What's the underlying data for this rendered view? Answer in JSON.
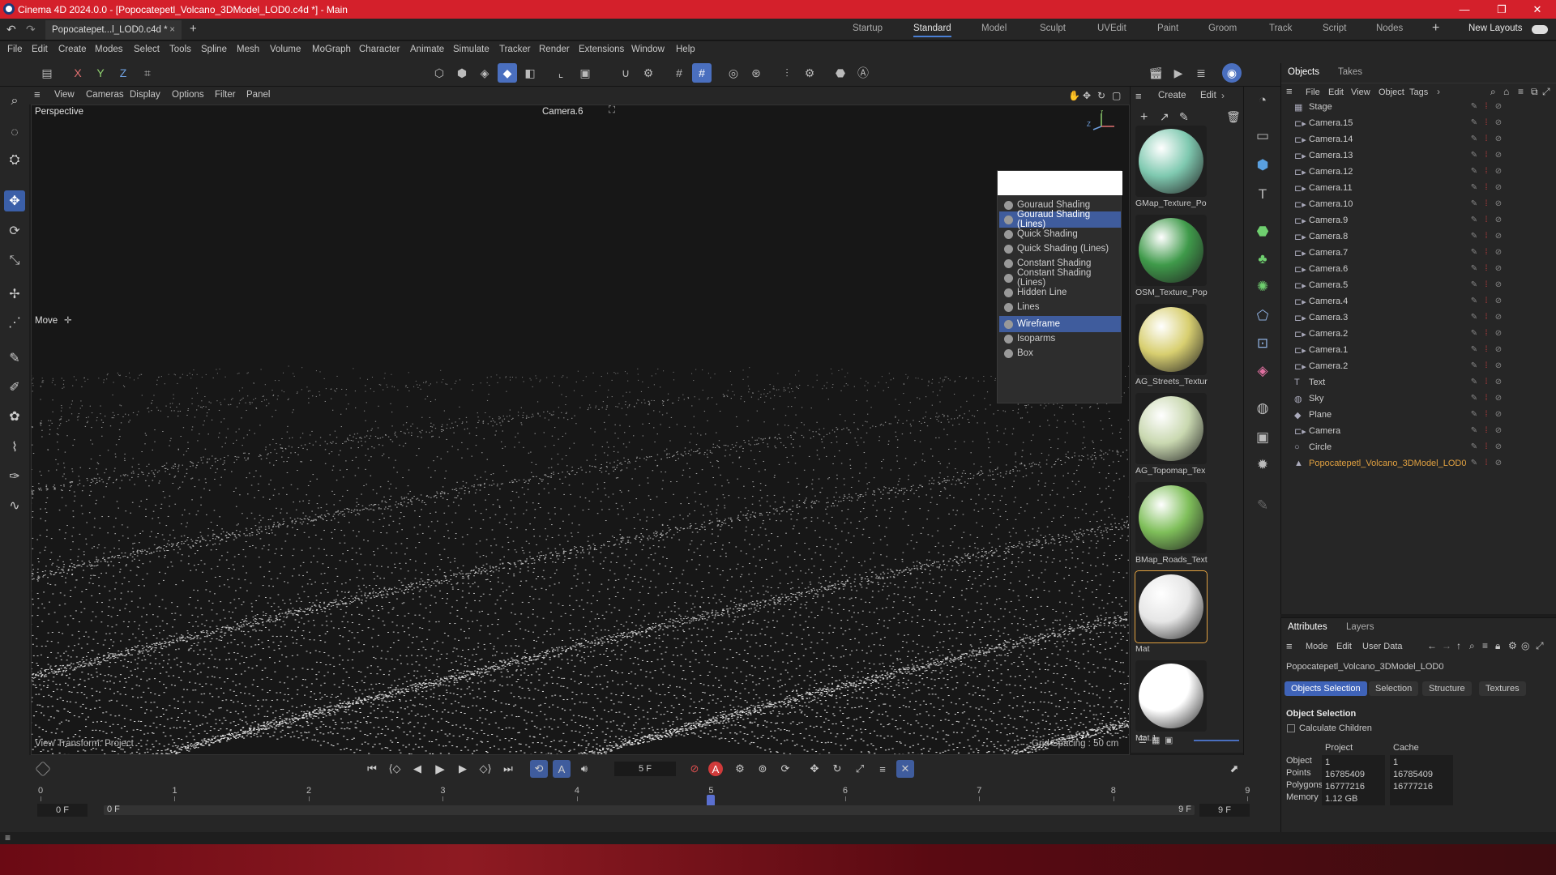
{
  "window": {
    "title": "Cinema 4D 2024.0.0 - [Popocatepetl_Volcano_3DModel_LOD0.c4d *] - Main",
    "minimize": "—",
    "maximize": "❐",
    "close": "✕"
  },
  "doc_tab": {
    "label": "Popocatepet...l_LOD0.c4d *",
    "close": "×",
    "add": "+"
  },
  "layouts": [
    "Startup",
    "Standard",
    "Model",
    "Sculpt",
    "UVEdit",
    "Paint",
    "Groom",
    "Track",
    "Script",
    "Nodes"
  ],
  "layouts_active": "Standard",
  "new_layouts": "New Layouts",
  "menu": [
    "File",
    "Edit",
    "Create",
    "Modes",
    "Select",
    "Tools",
    "Spline",
    "Mesh",
    "Volume",
    "MoGraph",
    "Character",
    "Animate",
    "Simulate",
    "Tracker",
    "Render",
    "Extensions",
    "Window",
    "Help"
  ],
  "axis_buttons": [
    "X",
    "Y",
    "Z"
  ],
  "viewport_menu": [
    "View",
    "Cameras",
    "Display",
    "Options",
    "Filter",
    "Panel"
  ],
  "viewport": {
    "projection": "Perspective",
    "camera": "Camera.6",
    "tool": "Move",
    "view_transform": "View Transform: Project",
    "grid_spacing": "Grid Spacing : 50 cm"
  },
  "shading_menu": {
    "items": [
      "Gouraud Shading",
      "Gouraud Shading (Lines)",
      "Quick Shading",
      "Quick Shading (Lines)",
      "Constant Shading",
      "Constant Shading (Lines)",
      "Hidden Line",
      "Lines",
      "Wireframe",
      "Isoparms",
      "Box"
    ],
    "selected": [
      "Gouraud Shading (Lines)",
      "Wireframe"
    ]
  },
  "material_panel": {
    "menu": [
      "Create",
      "Edit"
    ],
    "materials": [
      {
        "name": "GMap_Texture_Po",
        "color": "#7fc9b0"
      },
      {
        "name": "OSM_Texture_Pop",
        "color": "#3f9a4a"
      },
      {
        "name": "AG_Streets_Textur",
        "color": "#d8cf70"
      },
      {
        "name": "AG_Topomap_Tex",
        "color": "#c9d8b0"
      },
      {
        "name": "BMap_Roads_Text",
        "color": "#7fbf5a"
      },
      {
        "name": "Mat",
        "color": "#e6e6e6"
      },
      {
        "name": "Mat.1",
        "color": "#ffffff"
      }
    ]
  },
  "objects_panel": {
    "tabs": [
      "Objects",
      "Takes"
    ],
    "menu": [
      "File",
      "Edit",
      "View",
      "Object",
      "Tags"
    ],
    "objects": [
      {
        "name": "Stage",
        "icon": "stage-icon"
      },
      {
        "name": "Camera.15",
        "icon": "camera-icon"
      },
      {
        "name": "Camera.14",
        "icon": "camera-icon"
      },
      {
        "name": "Camera.13",
        "icon": "camera-icon"
      },
      {
        "name": "Camera.12",
        "icon": "camera-icon"
      },
      {
        "name": "Camera.11",
        "icon": "camera-icon"
      },
      {
        "name": "Camera.10",
        "icon": "camera-icon"
      },
      {
        "name": "Camera.9",
        "icon": "camera-icon"
      },
      {
        "name": "Camera.8",
        "icon": "camera-icon"
      },
      {
        "name": "Camera.7",
        "icon": "camera-icon"
      },
      {
        "name": "Camera.6",
        "icon": "camera-icon"
      },
      {
        "name": "Camera.5",
        "icon": "camera-icon"
      },
      {
        "name": "Camera.4",
        "icon": "camera-icon"
      },
      {
        "name": "Camera.3",
        "icon": "camera-icon"
      },
      {
        "name": "Camera.2",
        "icon": "camera-icon"
      },
      {
        "name": "Camera.1",
        "icon": "camera-icon"
      },
      {
        "name": "Camera.2",
        "icon": "camera-icon"
      },
      {
        "name": "Text",
        "icon": "text-icon"
      },
      {
        "name": "Sky",
        "icon": "sky-icon"
      },
      {
        "name": "Plane",
        "icon": "plane-icon"
      },
      {
        "name": "Camera",
        "icon": "camera-icon"
      },
      {
        "name": "Circle",
        "icon": "circle-icon"
      },
      {
        "name": "Popocatepetl_Volcano_3DModel_LOD0",
        "icon": "polygon-icon",
        "highlight": "#e0a040"
      }
    ]
  },
  "attributes_panel": {
    "tabs": [
      "Attributes",
      "Layers"
    ],
    "menu": [
      "Mode",
      "Edit",
      "User Data"
    ],
    "object_name": "Popocatepetl_Volcano_3DModel_LOD0",
    "subtabs": [
      "Objects Selection",
      "Selection",
      "Structure",
      "Textures"
    ],
    "section": "Object Selection",
    "calc_children": "Calculate Children",
    "col_project": "Project",
    "col_cache": "Cache",
    "rows": [
      {
        "label": "Object",
        "project": "1",
        "cache": "1"
      },
      {
        "label": "Points",
        "project": "16785409",
        "cache": "16785409"
      },
      {
        "label": "Polygons",
        "project": "16777216",
        "cache": "16777216"
      },
      {
        "label": "Memory",
        "project": "1.12 GB",
        "cache": ""
      }
    ]
  },
  "timeline": {
    "current_frame": "5 F",
    "ruler": [
      "0",
      "1",
      "2",
      "3",
      "4",
      "5",
      "6",
      "7",
      "8",
      "9"
    ],
    "start": "0 F",
    "range_start": "0 F",
    "range_end": "9 F",
    "end": "9 F",
    "playhead_frame": 5
  },
  "colors": {
    "accent": "#4a6fbf",
    "title_red": "#d4202b"
  }
}
